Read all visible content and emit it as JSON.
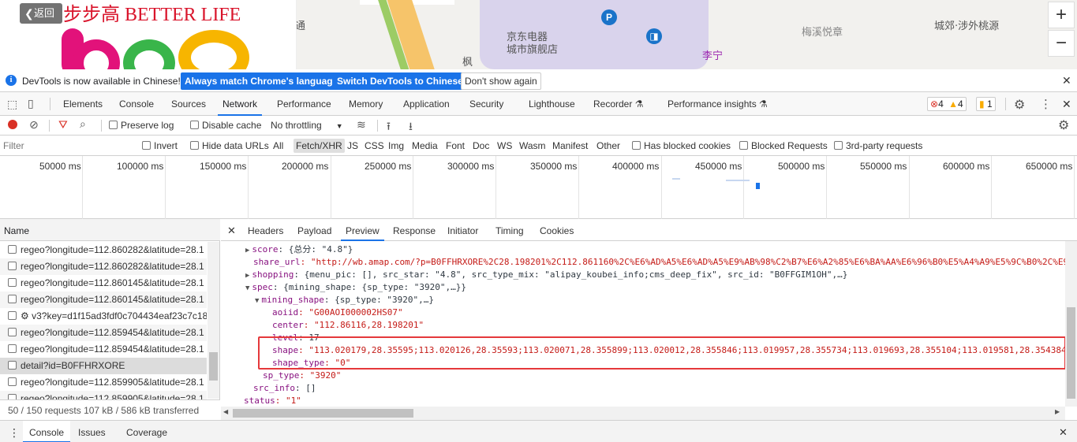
{
  "page": {
    "back_label": "返回",
    "brand_text": "步步高 BETTER LIFE",
    "map_labels": [
      "京东电器",
      "城市旗舰店",
      "李宁",
      "梅溪悦章",
      "城郊·涉外桃源",
      "通",
      "枫"
    ],
    "map_pin_p": "P",
    "zoom_in": "+",
    "zoom_out": "−"
  },
  "infobar": {
    "message": "DevTools is now available in Chinese!",
    "match_button": "Always match Chrome's language",
    "switch_button": "Switch DevTools to Chinese",
    "dismiss_button": "Don't show again",
    "close": "✕"
  },
  "tabs": [
    "Elements",
    "Console",
    "Sources",
    "Network",
    "Performance",
    "Memory",
    "Application",
    "Security",
    "Lighthouse",
    "Recorder ⚗",
    "Performance insights ⚗"
  ],
  "active_tab": "Network",
  "badges": {
    "errors": "4",
    "warnings": "4",
    "issues": "1"
  },
  "toolbar": {
    "preserve_log": "Preserve log",
    "disable_cache": "Disable cache",
    "throttling": "No throttling"
  },
  "filter": {
    "placeholder": "Filter",
    "invert": "Invert",
    "hide_data_urls": "Hide data URLs",
    "types": [
      "All",
      "Fetch/XHR",
      "JS",
      "CSS",
      "Img",
      "Media",
      "Font",
      "Doc",
      "WS",
      "Wasm",
      "Manifest",
      "Other"
    ],
    "selected_type": "Fetch/XHR",
    "blocked_cookies": "Has blocked cookies",
    "blocked_requests": "Blocked Requests",
    "third_party": "3rd-party requests"
  },
  "overview": {
    "ticks": [
      "50000 ms",
      "100000 ms",
      "150000 ms",
      "200000 ms",
      "250000 ms",
      "300000 ms",
      "350000 ms",
      "400000 ms",
      "450000 ms",
      "500000 ms",
      "550000 ms",
      "600000 ms",
      "650000 ms"
    ]
  },
  "requests": {
    "header": "Name",
    "rows": [
      "regeo?longitude=112.860282&latitude=28.1",
      "regeo?longitude=112.860282&latitude=28.1",
      "regeo?longitude=112.860145&latitude=28.1",
      "regeo?longitude=112.860145&latitude=28.1",
      "⚙ v3?key=d1f15ad3fdf0c704434eaf23c7c18",
      "regeo?longitude=112.859454&latitude=28.1",
      "regeo?longitude=112.859454&latitude=28.1",
      "detail?id=B0FFHRXORE",
      "regeo?longitude=112.859905&latitude=28.1",
      "regeo?longitude=112.859905&latitude=28.1"
    ],
    "selected_index": 7,
    "status": "50 / 150 requests    107 kB / 586 kB transferred"
  },
  "detail_tabs": [
    "Headers",
    "Payload",
    "Preview",
    "Response",
    "Initiator",
    "Timing",
    "Cookies"
  ],
  "active_detail_tab": "Preview",
  "preview": {
    "lines": [
      {
        "arrow": "▶",
        "key": "score",
        "text": ": {总分: \"4.8\"}",
        "str": false
      },
      {
        "arrow": "",
        "key": "share_url",
        "text": ": \"http://wb.amap.com/?p=B0FFHRXORE%2C28.198201%2C112.861160%2C%E6%AD%A5%E6%AD%A5%E9%AB%98%C2%B7%E6%A2%85%E6%BA%AA%E6%96%B0%E5%A4%A9%E5%9C%B0%2C%E9",
        "str": true
      },
      {
        "arrow": "▶",
        "key": "shopping",
        "text": ": {menu_pic: [], src_star: \"4.8\", src_type_mix: \"alipay_koubei_info;cms_deep_fix\", src_id: \"B0FFGIM1OH\",…}",
        "str": false
      },
      {
        "arrow": "▼",
        "key": "spec",
        "text": ": {mining_shape: {sp_type: \"3920\",…}}",
        "str": false
      },
      {
        "arrow": "▼",
        "key": "mining_shape",
        "text": ": {sp_type: \"3920\",…}",
        "str": false
      },
      {
        "arrow": "",
        "key": "aoiid",
        "text": ": \"G00AOI000002HS07\"",
        "str": true
      },
      {
        "arrow": "",
        "key": "center",
        "text": ": \"112.86116,28.198201\"",
        "str": true
      },
      {
        "arrow": "",
        "key": "level",
        "text": ": 17",
        "str": false
      },
      {
        "arrow": "",
        "key": "shape",
        "text": ": \"113.020179,28.35595;113.020126,28.35593;113.020071,28.355899;113.020012,28.355846;113.019957,28.355734;113.019693,28.355104;113.019581,28.354384",
        "str": true
      },
      {
        "arrow": "",
        "key": "shape_type",
        "text": ": \"0\"",
        "str": true
      },
      {
        "arrow": "",
        "key": "sp_type",
        "text": ": \"3920\"",
        "str": true
      },
      {
        "arrow": "",
        "key": "src_info",
        "text": ": []",
        "str": false
      },
      {
        "arrow": "",
        "key": "status",
        "text": ": \"1\"",
        "str": true
      }
    ]
  },
  "drawer": {
    "tabs": [
      "Console",
      "Issues",
      "Coverage"
    ],
    "active": "Console",
    "close": "✕"
  },
  "colors": {
    "accent": "#1a73e8",
    "highlight_border": "#e5383b",
    "json_key": "#881280",
    "json_string": "#c41a16",
    "record_red": "#d93025",
    "error_red": "#d93025",
    "warning_yellow": "#f9ab00"
  }
}
